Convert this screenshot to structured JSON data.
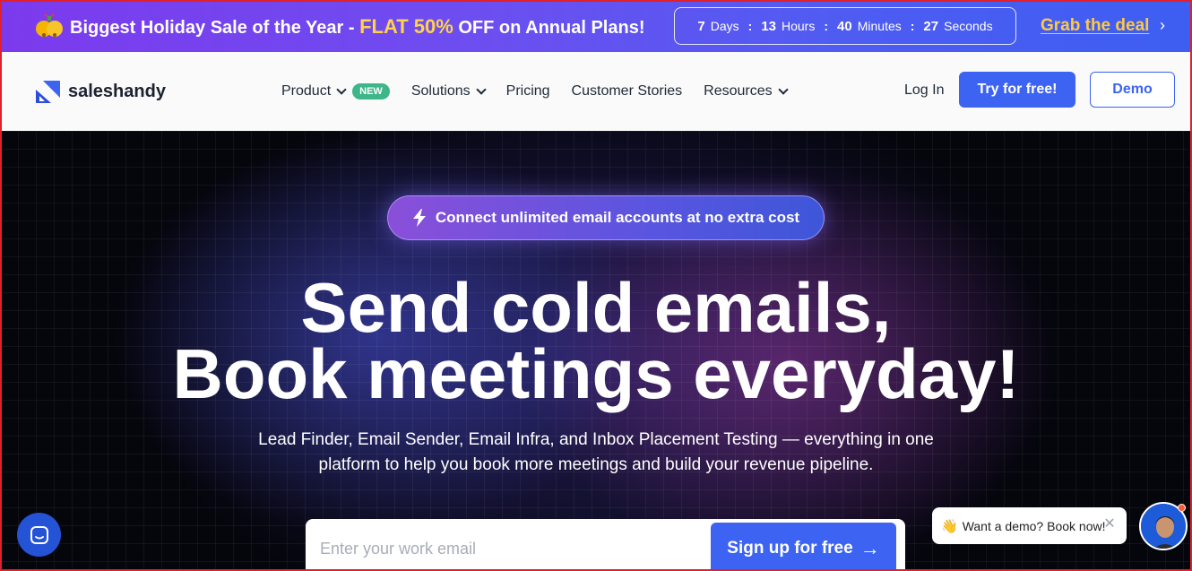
{
  "promo": {
    "headline_prefix": "Biggest Holiday Sale of the Year - ",
    "headline_highlight": "FLAT 50%",
    "headline_suffix": " OFF on Annual Plans!",
    "countdown": {
      "days_value": "7",
      "days_label": "Days",
      "hours_value": "13",
      "hours_label": "Hours",
      "minutes_value": "40",
      "minutes_label": "Minutes",
      "seconds_value": "27",
      "seconds_label": "Seconds",
      "separator": ":"
    },
    "cta": "Grab the deal",
    "cta_icon": "chevron-right-icon",
    "icon": "gift-bells-icon"
  },
  "nav": {
    "brand": "saleshandy",
    "items": [
      {
        "label": "Product",
        "has_dropdown": true,
        "badge": "NEW"
      },
      {
        "label": "Solutions",
        "has_dropdown": true
      },
      {
        "label": "Pricing",
        "has_dropdown": false
      },
      {
        "label": "Customer Stories",
        "has_dropdown": false
      },
      {
        "label": "Resources",
        "has_dropdown": true
      }
    ],
    "login": "Log In",
    "try_free": "Try for free!",
    "demo": "Demo"
  },
  "hero": {
    "pill_text": "Connect unlimited email accounts at no extra cost",
    "pill_icon": "lightning-icon",
    "title_line1": "Send cold emails,",
    "title_line2": "Book meetings everyday!",
    "subtitle_line1": "Lead Finder, Email Sender, Email Infra, and Inbox Placement Testing — everything in one",
    "subtitle_line2": "platform to help you book more meetings and build your revenue pipeline.",
    "email_placeholder": "Enter your work email",
    "signup_label": "Sign up for free",
    "signup_icon": "arrow-right-icon"
  },
  "widgets": {
    "demo_bubble_text": "Want a demo? Book now!",
    "demo_bubble_icon": "waving-hand-icon",
    "chat_icon": "chat-icon"
  },
  "colors": {
    "accent": "#3d63f2",
    "promo_highlight": "#ffd24a",
    "grab_deal": "#ffc940",
    "new_badge": "#3fb58a"
  }
}
